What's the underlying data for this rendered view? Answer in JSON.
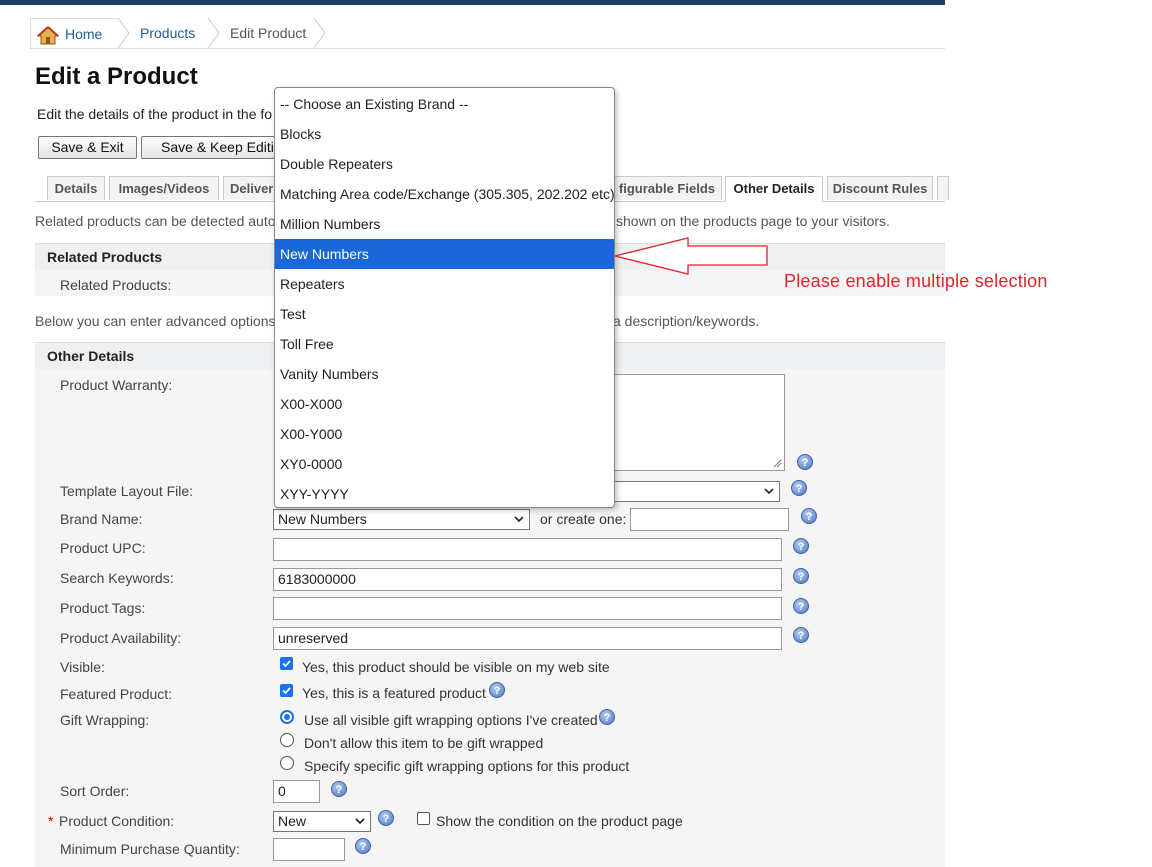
{
  "breadcrumb": {
    "home": "Home",
    "products": "Products",
    "current": "Edit Product"
  },
  "page": {
    "title": "Edit a Product",
    "subtitle": "Edit the details of the product in the fo"
  },
  "buttons": {
    "save_exit": "Save & Exit",
    "save_keep": "Save & Keep Editing"
  },
  "tabs": [
    "Details",
    "Images/Videos",
    "Deliver",
    "figurable Fields",
    "Other Details",
    "Discount Rules"
  ],
  "active_tab": "Other Details",
  "info": {
    "related_left": "Related products can be detected autor",
    "related_right": "shown on the products page to your visitors.",
    "advanced_left": "Below you can enter advanced options",
    "advanced_right": "a description/keywords."
  },
  "sections": {
    "related": "Related Products",
    "other": "Other Details"
  },
  "fields": {
    "related_products_label": "Related Products:",
    "warranty_label": "Product Warranty:",
    "template_label": "Template Layout File:",
    "brand_label": "Brand Name:",
    "brand_value": "New Numbers",
    "or_create": "or create one:",
    "upc_label": "Product UPC:",
    "keywords_label": "Search Keywords:",
    "keywords_value": "6183000000",
    "tags_label": "Product Tags:",
    "availability_label": "Product Availability:",
    "availability_value": "unreserved",
    "visible_label": "Visible:",
    "visible_text": "Yes, this product should be visible on my web site",
    "featured_label": "Featured Product:",
    "featured_text": "Yes, this is a featured product",
    "gift_label": "Gift Wrapping:",
    "gift_opt1": "Use all visible gift wrapping options I've created",
    "gift_opt2": "Don't allow this item to be gift wrapped",
    "gift_opt3": "Specify specific gift wrapping options for this product",
    "sort_label": "Sort Order:",
    "sort_value": "0",
    "condition_label": "Product Condition:",
    "condition_value": "New",
    "condition_show": "Show the condition on the product page",
    "min_qty_label": "Minimum Purchase Quantity:",
    "required_mark": "*"
  },
  "brand_dropdown": {
    "options": [
      "-- Choose an Existing Brand --",
      "Blocks",
      "Double Repeaters",
      "Matching Area code/Exchange (305.305, 202.202 etc)",
      "Million Numbers",
      "New Numbers",
      "Repeaters",
      "Test",
      "Toll Free",
      "Vanity Numbers",
      "X00-X000",
      "X00-Y000",
      "XY0-0000",
      "XYY-YYYY"
    ],
    "selected": "New Numbers"
  },
  "annotation": "Please enable multiple selection",
  "colors": {
    "topbar": "#1f3e68",
    "selected": "#1a68d8",
    "annotation": "#e0252a",
    "link": "#1f5c99"
  },
  "icons": [
    "home-icon",
    "help-icon",
    "chevron-down-icon",
    "arrow-annotation"
  ]
}
